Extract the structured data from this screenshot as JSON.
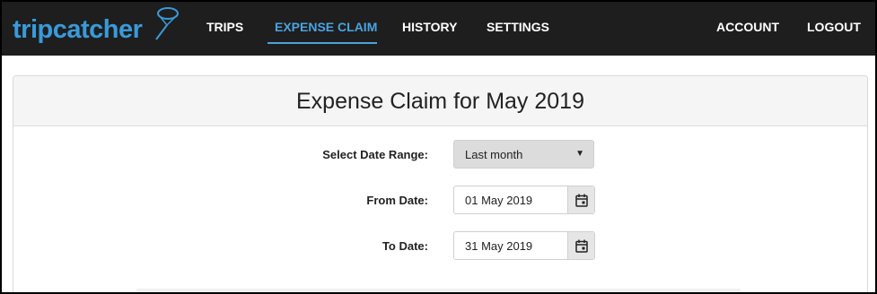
{
  "brand": {
    "name": "tripcatcher"
  },
  "nav": {
    "trips": "TRIPS",
    "expense_claim": "EXPENSE CLAIM",
    "history": "HISTORY",
    "settings": "SETTINGS",
    "account": "ACCOUNT",
    "logout": "LOGOUT",
    "active": "expense_claim"
  },
  "panel": {
    "title": "Expense Claim for May 2019"
  },
  "form": {
    "date_range_label": "Select Date Range:",
    "date_range_value": "Last month",
    "from_label": "From Date:",
    "from_value": "01 May 2019",
    "to_label": "To Date:",
    "to_value": "31 May 2019"
  },
  "icons": {
    "calendar": "calendar-icon",
    "caret": "caret-down-icon",
    "logo_net": "butterfly-net-icon"
  },
  "colors": {
    "navbar_bg": "#1e1e1e",
    "accent": "#4aa3df",
    "logo": "#3a9ad9"
  }
}
